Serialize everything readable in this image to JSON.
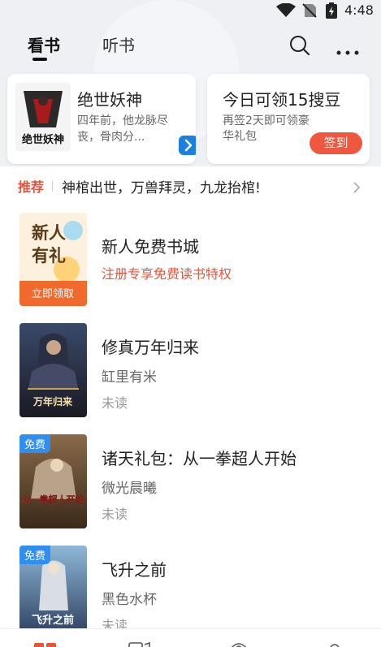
{
  "status_bar": {
    "time": "4:48"
  },
  "tabs": [
    {
      "label": "看书",
      "active": true
    },
    {
      "label": "听书",
      "active": false
    }
  ],
  "icons": {
    "search": "search-icon",
    "more": "more-icon"
  },
  "featured_card": {
    "title": "绝世妖神",
    "description": "四年前，他龙脉尽丧，骨肉分...",
    "cover_text": "绝世妖神"
  },
  "bonus_card": {
    "title": "今日可领15搜豆",
    "description": "再签2天即可领豪华礼包",
    "button": "签到"
  },
  "recommend": {
    "tag": "推荐",
    "text": "神棺出世，万兽拜灵，九龙抬棺!"
  },
  "promo": {
    "title": "新人免费书城",
    "subtitle": "注册专享免费读书特权",
    "cover_line1": "新人",
    "cover_line2": "有礼",
    "cover_button": "立即领取"
  },
  "books": [
    {
      "title": "修真万年归来",
      "author": "缸里有米",
      "status": "未读",
      "free": false,
      "cover_text": "万年归来"
    },
    {
      "title": "诸天礼包：从一拳超人开始",
      "author": "微光晨曦",
      "status": "未读",
      "free": true,
      "badge": "免费",
      "cover_text": "从一拳超人开始"
    },
    {
      "title": "飞升之前",
      "author": "黑色水杯",
      "status": "未读",
      "free": true,
      "badge": "免费",
      "cover_text": "飞升之前"
    }
  ],
  "colors": {
    "accent": "#e8533b",
    "badge_blue": "#2f8ff0",
    "checkin": "#f0573f"
  }
}
